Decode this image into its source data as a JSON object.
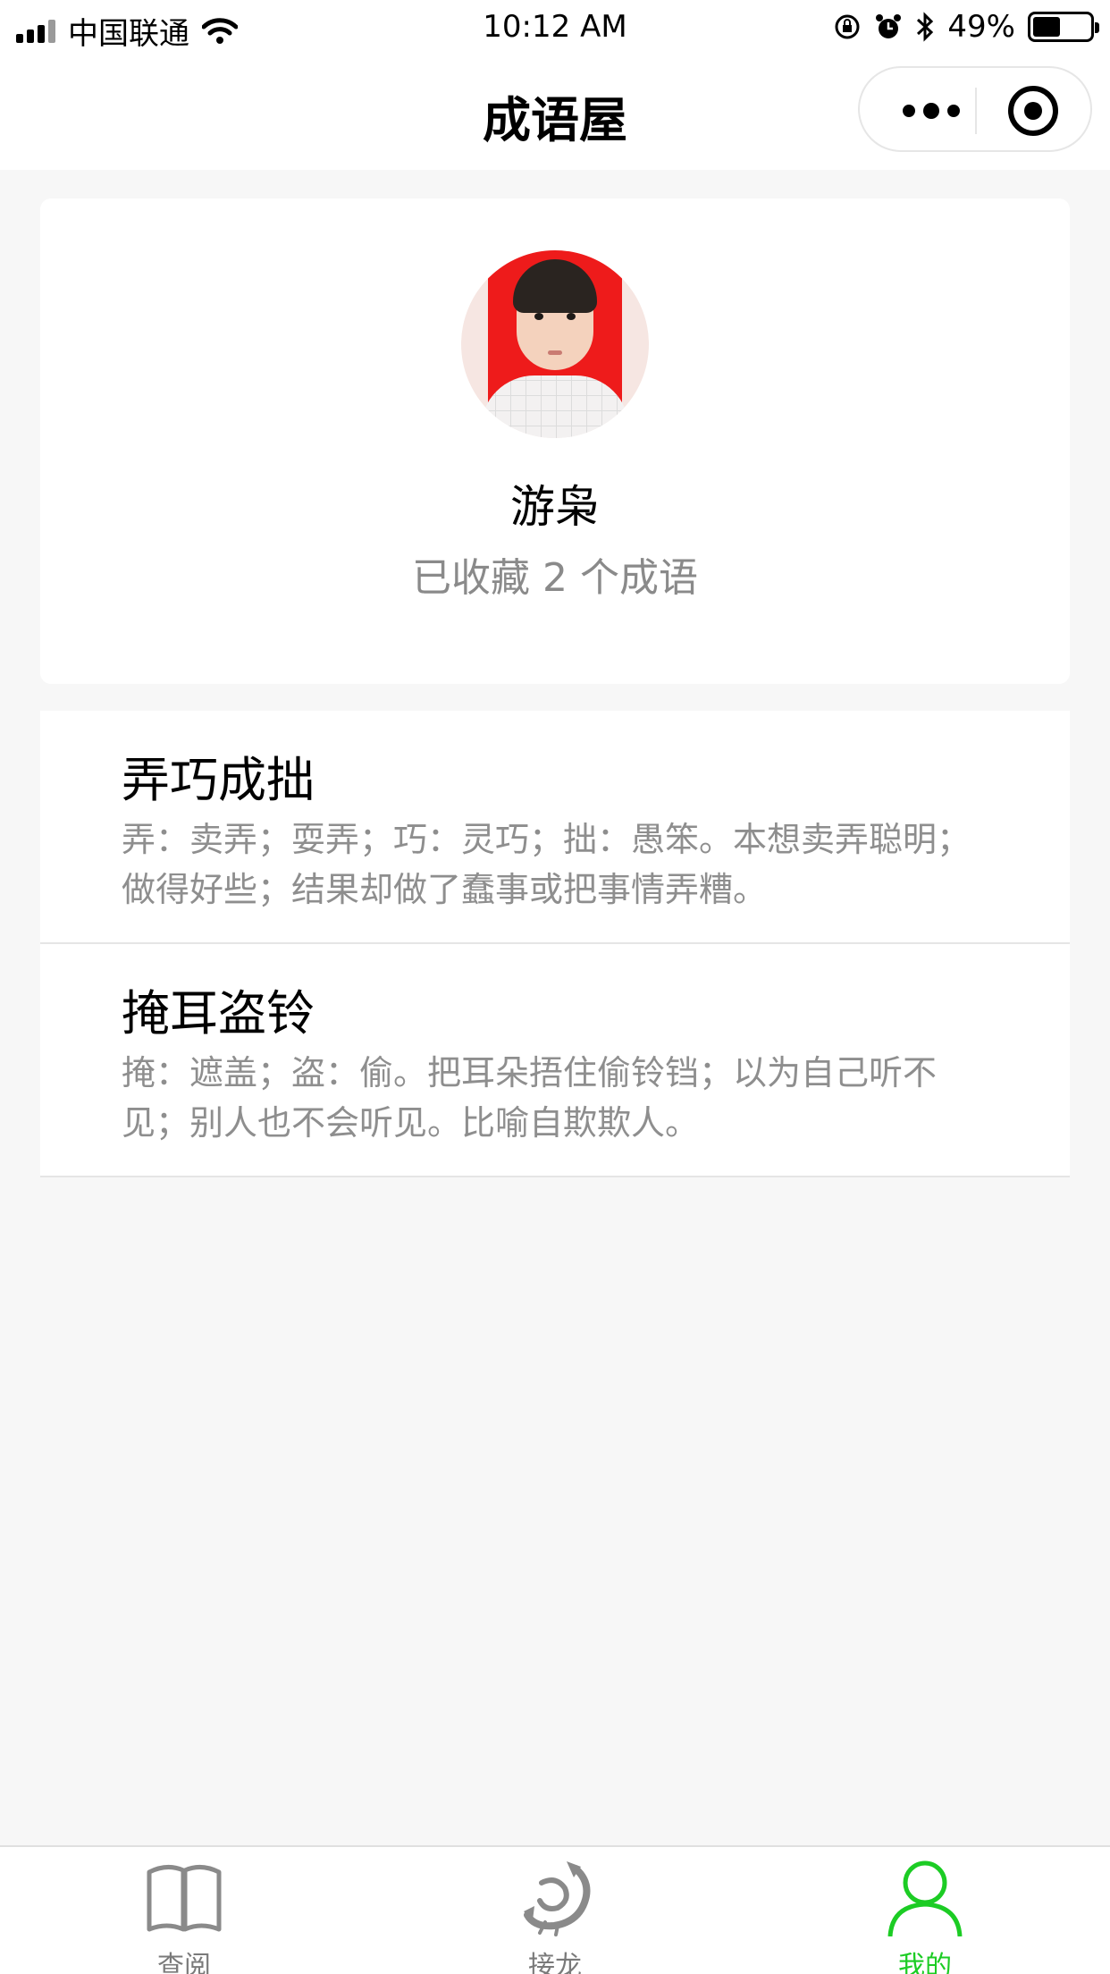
{
  "status_bar": {
    "carrier": "中国联通",
    "time": "10:12 AM",
    "battery": "49%",
    "battery_level": 0.49
  },
  "nav": {
    "title": "成语屋"
  },
  "profile": {
    "nickname": "游枭",
    "favorites_text": "已收藏 2 个成语"
  },
  "idioms": [
    {
      "title": "弄巧成拙",
      "desc": "弄：卖弄；耍弄；巧：灵巧；拙：愚笨。本想卖弄聪明；做得好些；结果却做了蠢事或把事情弄糟。"
    },
    {
      "title": "掩耳盗铃",
      "desc": "掩：遮盖；盗：偷。把耳朵捂住偷铃铛；以为自己听不见；别人也不会听见。比喻自欺欺人。"
    }
  ],
  "tabs": [
    {
      "label": "查阅",
      "icon": "book-icon",
      "active": false
    },
    {
      "label": "接龙",
      "icon": "dragon-icon",
      "active": false
    },
    {
      "label": "我的",
      "icon": "user-icon",
      "active": true
    }
  ],
  "colors": {
    "accent": "#1ccc24",
    "background": "#f7f7f7",
    "secondary_text": "#8e8e8e"
  }
}
